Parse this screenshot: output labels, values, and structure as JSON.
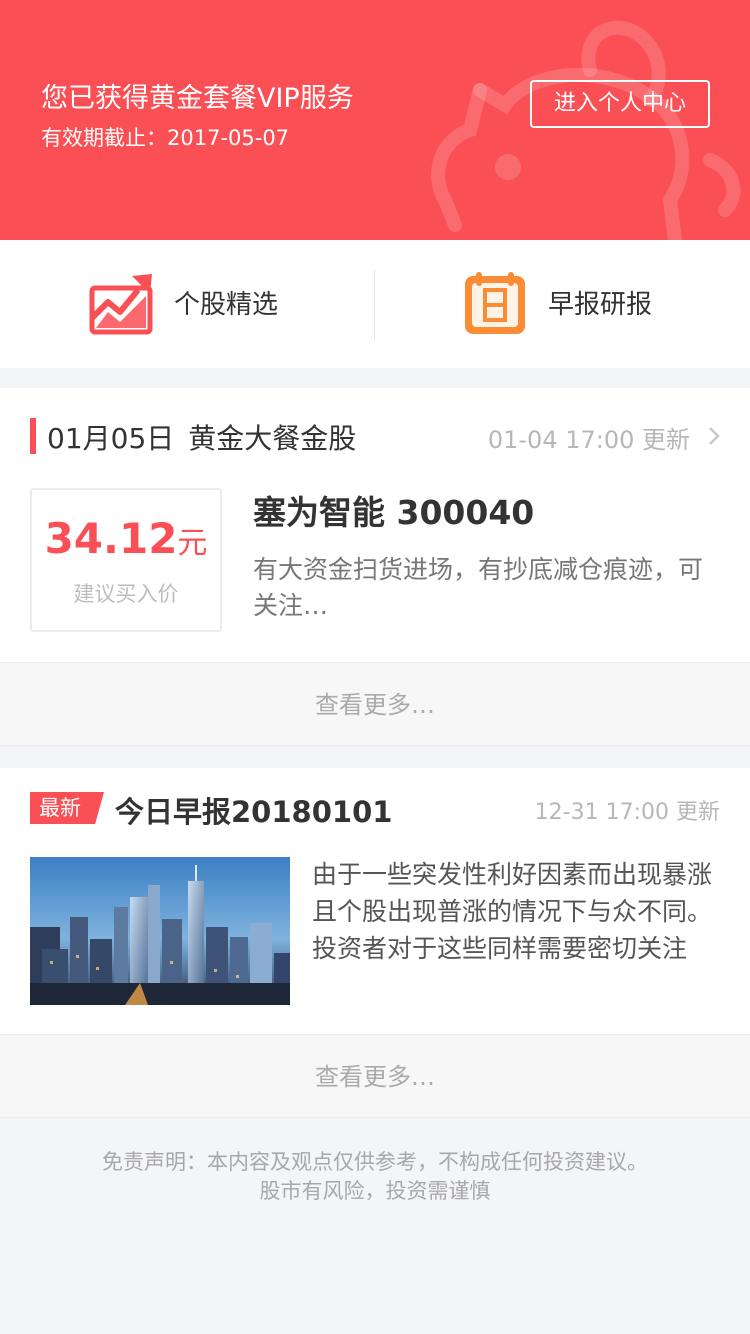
{
  "vip": {
    "title": "您已获得黄金套餐VIP服务",
    "expiry": "有效期截止：2017-05-07",
    "center_button": "进入个人中心"
  },
  "quick_entries": [
    {
      "label": "个股精选",
      "icon": "trend-chart-icon"
    },
    {
      "label": "早报研报",
      "icon": "calendar-report-icon"
    }
  ],
  "golden_pick": {
    "date": "01月05日",
    "title": "黄金大餐金股",
    "updated": "01-04 17:00 更新",
    "price": "34.12",
    "price_unit": "元",
    "price_caption": "建议买入价",
    "stock": "塞为智能 300040",
    "desc": "有大资金扫货进场，有抄底减仓痕迹，可关注…",
    "more": "查看更多…"
  },
  "briefing": {
    "badge": "最新",
    "title": "今日早报20180101",
    "updated": "12-31 17:00 更新",
    "desc": "由于一些突发性利好因素而出现暴涨且个股出现普涨的情况下与众不同。投资者对于这些同样需要密切关注",
    "more": "查看更多…"
  },
  "disclaimer": {
    "line1": "免责声明：本内容及观点仅供参考，不构成任何投资建议。",
    "line2": "股市有风险，投资需谨慎"
  },
  "colors": {
    "brand_red": "#fa4f55",
    "accent_orange": "#fa8c35",
    "background": "#f4f5f9"
  }
}
